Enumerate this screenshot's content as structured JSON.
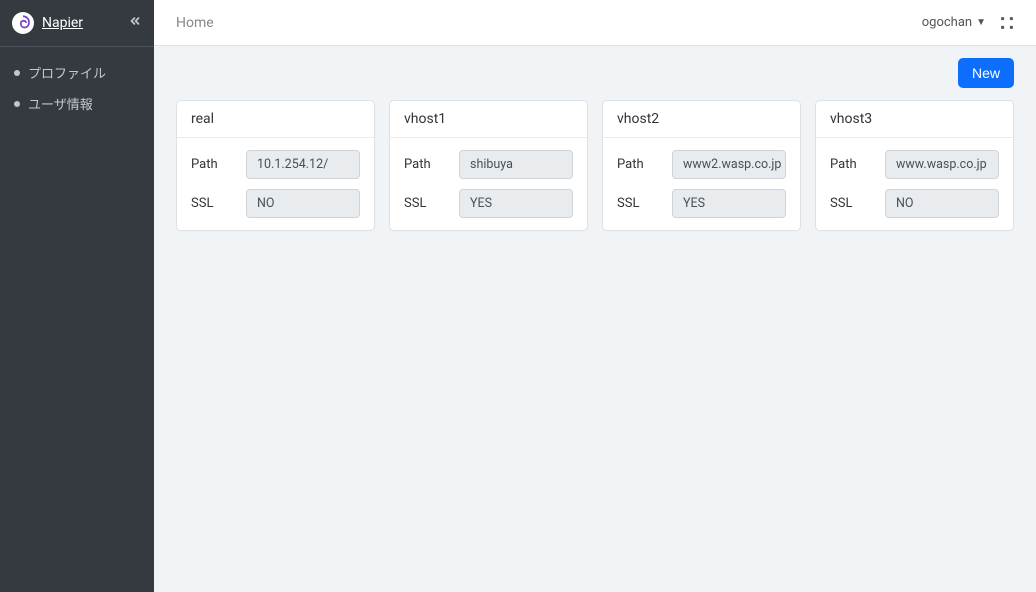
{
  "brand": {
    "name": "Napier"
  },
  "sidebar": {
    "items": [
      {
        "label": "プロファイル"
      },
      {
        "label": "ユーザ情報"
      }
    ]
  },
  "topbar": {
    "breadcrumb": "Home",
    "user": "ogochan"
  },
  "actions": {
    "new_label": "New"
  },
  "cards": [
    {
      "title": "real",
      "path_label": "Path",
      "path_value": "10.1.254.12/",
      "ssl_label": "SSL",
      "ssl_value": "NO"
    },
    {
      "title": "vhost1",
      "path_label": "Path",
      "path_value": "shibuya",
      "ssl_label": "SSL",
      "ssl_value": "YES"
    },
    {
      "title": "vhost2",
      "path_label": "Path",
      "path_value": "www2.wasp.co.jp",
      "ssl_label": "SSL",
      "ssl_value": "YES"
    },
    {
      "title": "vhost3",
      "path_label": "Path",
      "path_value": "www.wasp.co.jp",
      "ssl_label": "SSL",
      "ssl_value": "NO"
    }
  ]
}
